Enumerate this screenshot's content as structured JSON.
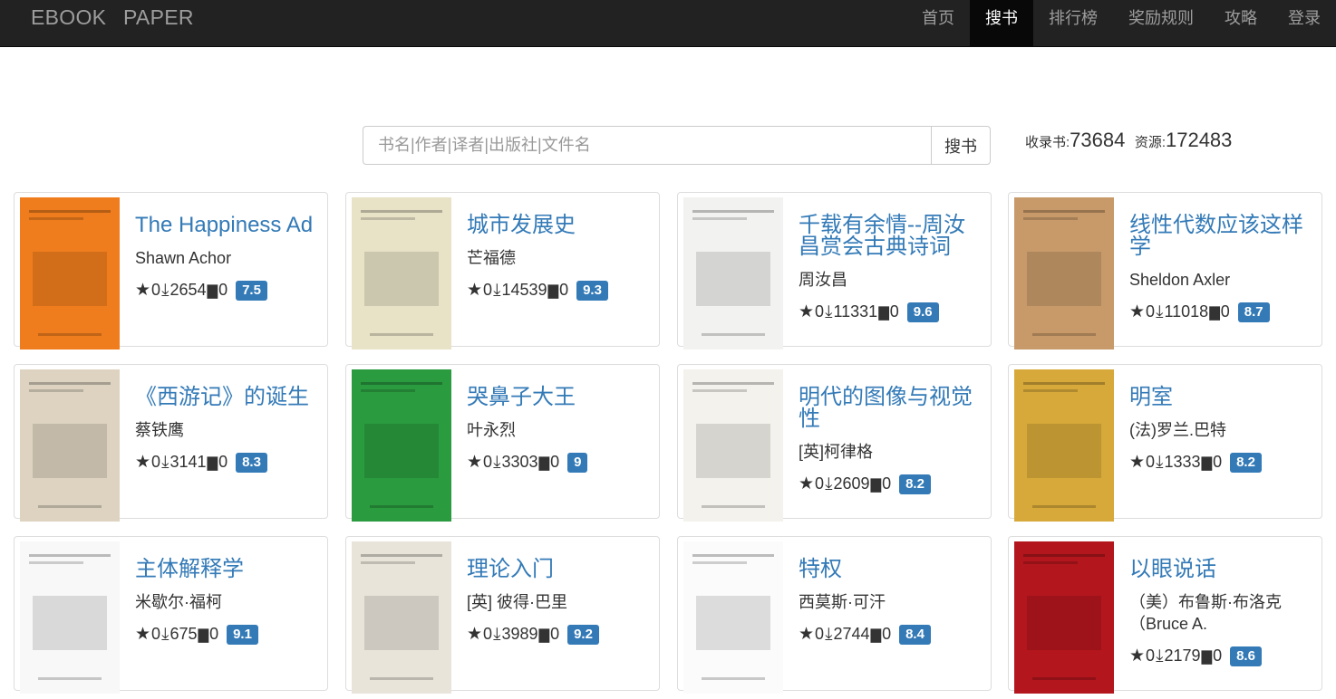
{
  "brand": "EBOOK PAPER",
  "nav": [
    "首页",
    "搜书",
    "排行榜",
    "奖励规则",
    "攻略",
    "登录"
  ],
  "search": {
    "placeholder": "书名|作者|译者|出版社|文件名",
    "button": "搜书"
  },
  "stats": {
    "books_label": "收录书:",
    "books": "73684",
    "res_label": "资源:",
    "res": "172483"
  },
  "books": [
    {
      "title": "The Happiness Ad",
      "author": "Shawn Achor",
      "likes": "0",
      "downloads": "2654",
      "comments": "0",
      "rating": "7.5",
      "cover": "#f07d1d"
    },
    {
      "title": "城市发展史",
      "author": "芒福德",
      "likes": "0",
      "downloads": "14539",
      "comments": "0",
      "rating": "9.3",
      "cover": "#e8e2c6"
    },
    {
      "title": "千载有余情--周汝昌赏会古典诗词",
      "author": "周汝昌",
      "likes": "0",
      "downloads": "11331",
      "comments": "0",
      "rating": "9.6",
      "cover": "#f2f2f0"
    },
    {
      "title": "线性代数应该这样学",
      "author": "Sheldon Axler",
      "likes": "0",
      "downloads": "11018",
      "comments": "0",
      "rating": "8.7",
      "cover": "#c89a6a"
    },
    {
      "title": "《西游记》的诞生",
      "author": "蔡铁鹰",
      "likes": "0",
      "downloads": "3141",
      "comments": "0",
      "rating": "8.3",
      "cover": "#ddd3c0"
    },
    {
      "title": "哭鼻子大王",
      "author": "叶永烈",
      "likes": "0",
      "downloads": "3303",
      "comments": "0",
      "rating": "9",
      "cover": "#2a9b3f"
    },
    {
      "title": "明代的图像与视觉性",
      "author": "[英]柯律格",
      "likes": "0",
      "downloads": "2609",
      "comments": "0",
      "rating": "8.2",
      "cover": "#f4f2ec"
    },
    {
      "title": "明室",
      "author": "(法)罗兰.巴特",
      "likes": "0",
      "downloads": "1333",
      "comments": "0",
      "rating": "8.2",
      "cover": "#d7a93a"
    },
    {
      "title": "主体解释学",
      "author": "米歇尔·福柯",
      "likes": "0",
      "downloads": "675",
      "comments": "0",
      "rating": "9.1",
      "cover": "#f8f8f8"
    },
    {
      "title": "理论入门",
      "author": "[英] 彼得·巴里",
      "likes": "0",
      "downloads": "3989",
      "comments": "0",
      "rating": "9.2",
      "cover": "#e9e4da"
    },
    {
      "title": "特权",
      "author": "西莫斯·可汗",
      "likes": "0",
      "downloads": "2744",
      "comments": "0",
      "rating": "8.4",
      "cover": "#fbfbfb"
    },
    {
      "title": "以眼说话",
      "author": "（美）布鲁斯·布洛克（Bruce A.",
      "likes": "0",
      "downloads": "2179",
      "comments": "0",
      "rating": "8.6",
      "cover": "#b3161d"
    }
  ]
}
